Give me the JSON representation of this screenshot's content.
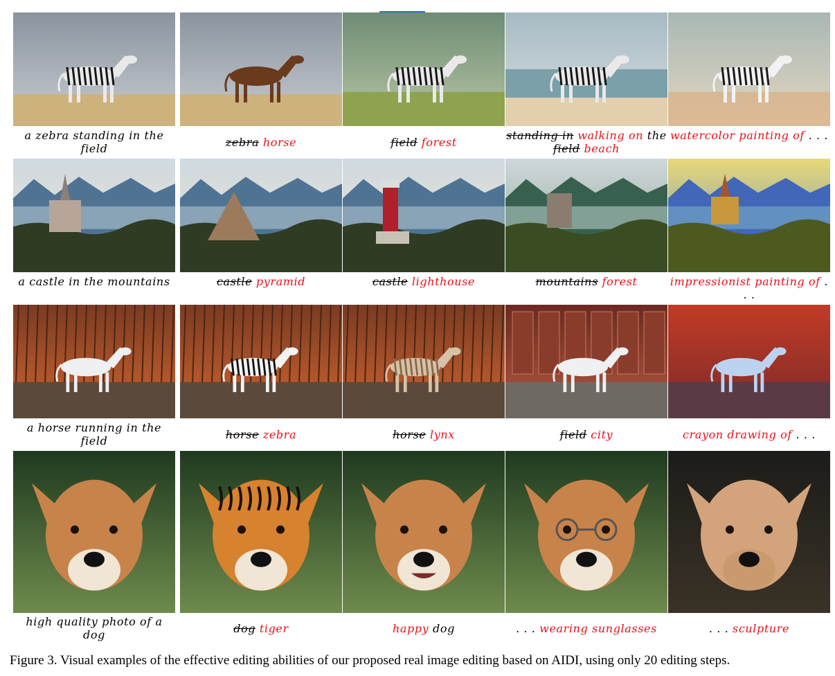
{
  "figure": {
    "caption": "Figure 3. Visual examples of the effective editing abilities of our proposed real image editing based on AIDI, using only 20 editing steps."
  },
  "rows": [
    {
      "source_caption": "a zebra standing in the field",
      "images": [
        {
          "depicts": "zebra standing in dry grass field under cloudy sky",
          "subject": "zebra",
          "scene": "field"
        },
        {
          "depicts": "horse standing in dry grass field under cloudy sky",
          "subject": "horse",
          "scene": "field"
        },
        {
          "depicts": "zebra standing in green forest",
          "subject": "zebra",
          "scene": "forest"
        },
        {
          "depicts": "zebra walking on the beach",
          "subject": "zebra",
          "scene": "beach"
        },
        {
          "depicts": "watercolor painting of a zebra",
          "subject": "zebra",
          "scene": "watercolor"
        }
      ],
      "edits": [
        {
          "parts": [
            {
              "text": "zebra",
              "style": "strike"
            },
            {
              "text": " horse",
              "style": "red"
            }
          ]
        },
        {
          "parts": [
            {
              "text": "field",
              "style": "strike"
            },
            {
              "text": " forest",
              "style": "red"
            }
          ]
        },
        {
          "parts": [
            {
              "text": "standing in",
              "style": "strike"
            },
            {
              "text": " walking on",
              "style": "red"
            },
            {
              "text": " the ",
              "style": "blk"
            },
            {
              "text": "field",
              "style": "strike"
            },
            {
              "text": " beach",
              "style": "red"
            }
          ]
        },
        {
          "parts": [
            {
              "text": "watercolor painting of",
              "style": "red"
            },
            {
              "text": " . . .",
              "style": "blk"
            }
          ]
        }
      ]
    },
    {
      "source_caption": "a castle in the mountains",
      "images": [
        {
          "depicts": "castle in the mountains",
          "subject": "castle",
          "scene": "mountains"
        },
        {
          "depicts": "pyramid in the mountains",
          "subject": "pyramid",
          "scene": "mountains"
        },
        {
          "depicts": "lighthouse in the mountains",
          "subject": "lighthouse",
          "scene": "mountains"
        },
        {
          "depicts": "castle in a forest",
          "subject": "castle",
          "scene": "forest"
        },
        {
          "depicts": "impressionist painting of a castle",
          "subject": "castle",
          "scene": "impressionist"
        }
      ],
      "edits": [
        {
          "parts": [
            {
              "text": "castle",
              "style": "strike"
            },
            {
              "text": " pyramid",
              "style": "red"
            }
          ]
        },
        {
          "parts": [
            {
              "text": "castle",
              "style": "strike"
            },
            {
              "text": " lighthouse",
              "style": "red"
            }
          ]
        },
        {
          "parts": [
            {
              "text": "mountains",
              "style": "strike"
            },
            {
              "text": " forest",
              "style": "red"
            }
          ]
        },
        {
          "parts": [
            {
              "text": "impressionist painting of",
              "style": "red"
            },
            {
              "text": " . . .",
              "style": "blk"
            }
          ]
        }
      ]
    },
    {
      "source_caption": "a horse running in the field",
      "images": [
        {
          "depicts": "white horse running in the field",
          "subject": "horse",
          "scene": "field"
        },
        {
          "depicts": "zebra running in the field",
          "subject": "zebra",
          "scene": "field"
        },
        {
          "depicts": "lynx running in the field",
          "subject": "lynx",
          "scene": "field"
        },
        {
          "depicts": "horse running in the city",
          "subject": "horse",
          "scene": "city"
        },
        {
          "depicts": "crayon drawing of a horse",
          "subject": "horse",
          "scene": "crayon"
        }
      ],
      "edits": [
        {
          "parts": [
            {
              "text": "horse",
              "style": "strike"
            },
            {
              "text": " zebra",
              "style": "red"
            }
          ]
        },
        {
          "parts": [
            {
              "text": "horse",
              "style": "strike"
            },
            {
              "text": " lynx",
              "style": "red"
            }
          ]
        },
        {
          "parts": [
            {
              "text": "field",
              "style": "strike"
            },
            {
              "text": " city",
              "style": "red"
            }
          ]
        },
        {
          "parts": [
            {
              "text": "crayon drawing of",
              "style": "red"
            },
            {
              "text": " . . .",
              "style": "blk"
            }
          ]
        }
      ]
    },
    {
      "source_caption": "high quality photo of a dog",
      "images": [
        {
          "depicts": "photo of a dog",
          "subject": "dog",
          "scene": "grass"
        },
        {
          "depicts": "photo of a tiger",
          "subject": "tiger",
          "scene": "grass"
        },
        {
          "depicts": "photo of a happy dog",
          "subject": "happy-dog",
          "scene": "grass"
        },
        {
          "depicts": "dog wearing sunglasses",
          "subject": "dog-glasses",
          "scene": "grass"
        },
        {
          "depicts": "dog sculpture",
          "subject": "sculpture",
          "scene": "plain"
        }
      ],
      "edits": [
        {
          "parts": [
            {
              "text": "dog",
              "style": "strike"
            },
            {
              "text": " tiger",
              "style": "red"
            }
          ]
        },
        {
          "parts": [
            {
              "text": "happy",
              "style": "red"
            },
            {
              "text": " dog",
              "style": "blk"
            }
          ]
        },
        {
          "parts": [
            {
              "text": ". . .",
              "style": "blk"
            },
            {
              "text": " wearing sunglasses",
              "style": "red"
            }
          ]
        },
        {
          "parts": [
            {
              "text": ". . .",
              "style": "blk"
            },
            {
              "text": " sculpture",
              "style": "red"
            }
          ]
        }
      ]
    }
  ]
}
